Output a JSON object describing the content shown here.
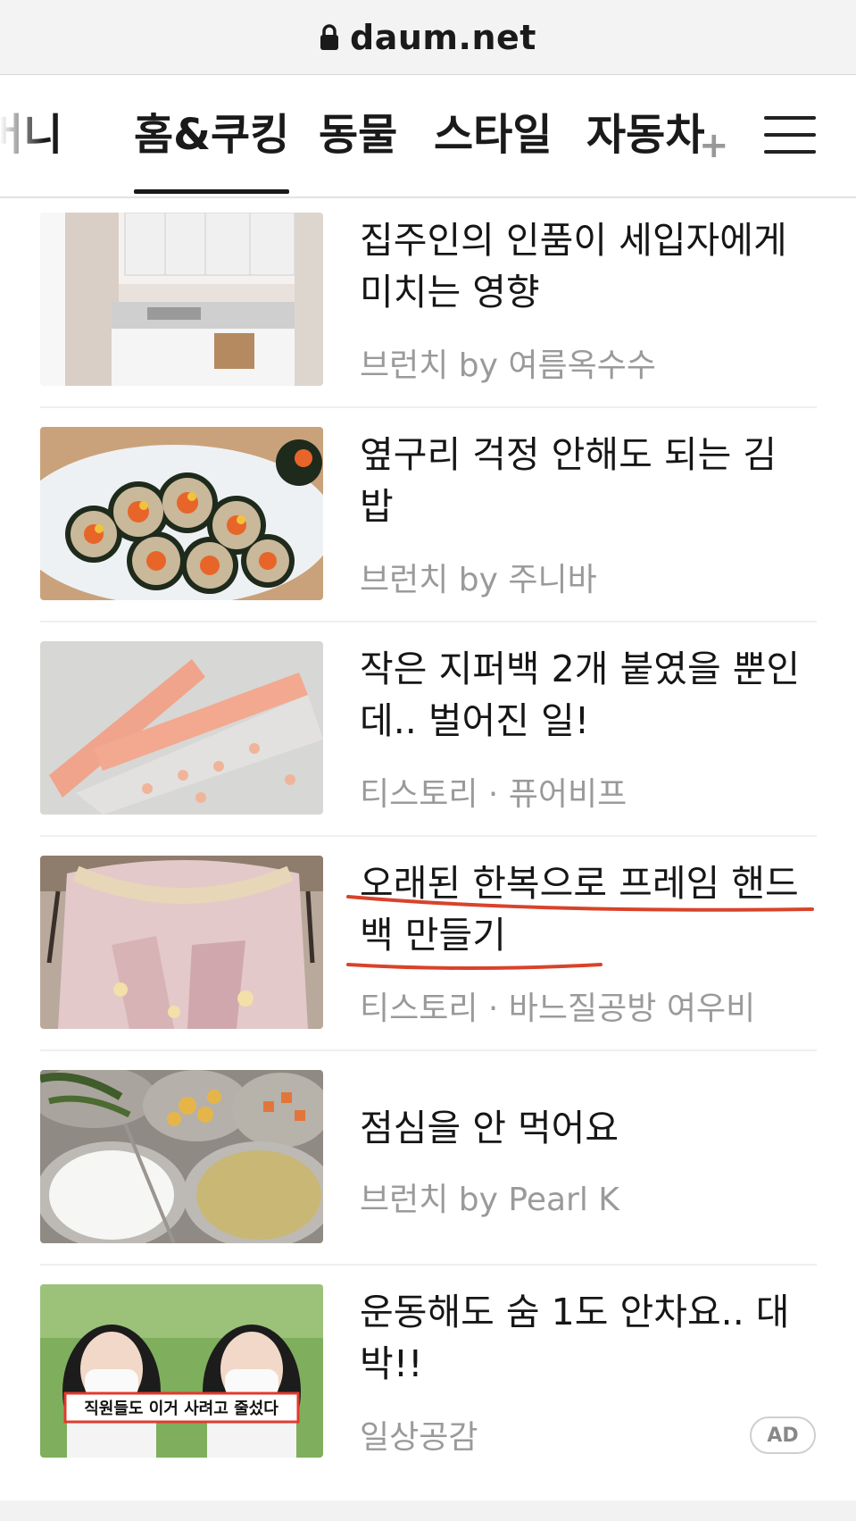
{
  "browser": {
    "url": "daum.net",
    "lock_icon": "lock-icon"
  },
  "tabs": [
    {
      "label": "머니"
    },
    {
      "label": "홈&쿠킹"
    },
    {
      "label": "동물"
    },
    {
      "label": "스타일"
    },
    {
      "label": "자동차"
    }
  ],
  "tabs_more": "+",
  "active_tab": "홈&쿠킹",
  "menu_icon": "hamburger-menu-icon",
  "articles": [
    {
      "title": "집주인의 인품이 세입자에게 미치는 영향",
      "source": "브런치 by 여름옥수수"
    },
    {
      "title": "옆구리 걱정 안해도 되는 김밥",
      "source": "브런치 by 주니바"
    },
    {
      "title": "작은 지퍼백 2개 붙였을 뿐인데.. 벌어진 일!",
      "source": "티스토리 · 퓨어비프"
    },
    {
      "title": "오래된 한복으로 프레임 핸드백 만들기",
      "source": "티스토리 · 바느질공방 여우비"
    },
    {
      "title": "점심을 안 먹어요",
      "source": "브런치 by Pearl K"
    },
    {
      "title": "운동해도 숨 1도 안차요.. 대박!!",
      "source": "일상공감",
      "thumb_caption": "직원들도 이거 사려고 줄섰다",
      "badge": "AD"
    }
  ],
  "colors": {
    "underline": "#d8432b",
    "source_text": "#9a9a9a",
    "ad_thumb_bg": "#7fae5c"
  }
}
